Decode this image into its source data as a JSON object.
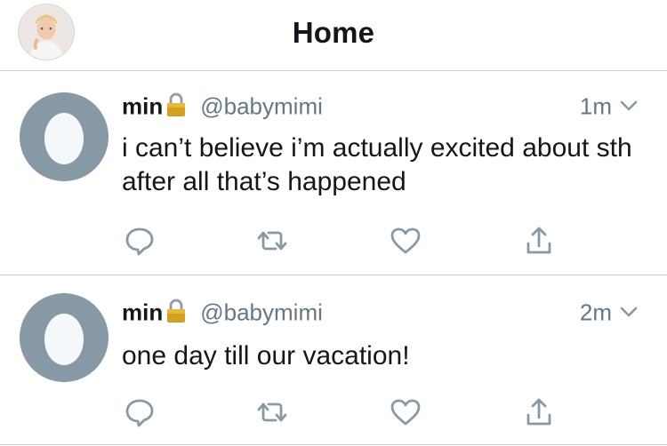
{
  "header": {
    "title": "Home",
    "avatar_icon": "profile-avatar"
  },
  "tweets": [
    {
      "name": "min",
      "protected_icon": "lock-icon",
      "handle": "@babymimi",
      "time": "1m",
      "text": "i can’t believe i’m actually excited about sth after all that’s happened",
      "actions": [
        "reply-icon",
        "retweet-icon",
        "like-icon",
        "share-icon"
      ]
    },
    {
      "name": "min",
      "protected_icon": "lock-icon",
      "handle": "@babymimi",
      "time": "2m",
      "text": "one day till our vacation!",
      "actions": [
        "reply-icon",
        "retweet-icon",
        "like-icon",
        "share-icon"
      ]
    }
  ],
  "colors": {
    "text_primary": "#14171a",
    "text_secondary": "#657786",
    "icon_gray": "#8899a6",
    "divider": "#c8cdd1"
  }
}
